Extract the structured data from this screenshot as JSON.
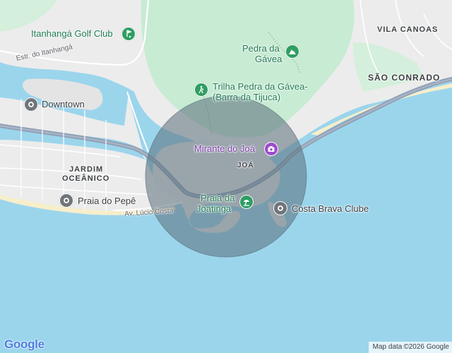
{
  "map": {
    "places": {
      "vila_canoas": "VILA CANOAS",
      "sao_conrado": "SÃO CONRADO",
      "jardim_oceanico_1": "JARDIM",
      "jardim_oceanico_2": "OCEÂNICO",
      "joa": "JOÁ"
    },
    "pois": {
      "itanhanga_golf": "Itanhangá Golf Club",
      "pedra_gavea_1": "Pedra da",
      "pedra_gavea_2": "Gávea",
      "trilha_1": "Trilha Pedra da Gávea-",
      "trilha_2": "(Barra da Tijuca)",
      "downtown": "Downtown",
      "mirante": "Mirante do Joá",
      "praia_pepe": "Praia do Pepê",
      "joatinga_1": "Praia da",
      "joatinga_2": "Joatinga",
      "costa_brava": "Costa Brava Clube"
    },
    "streets": {
      "estr_itanhanga": "Estr. do Itanhangá",
      "av_lucio_costa": "Av. Lúcio Costa"
    },
    "branding": {
      "logo": "Google",
      "attribution_label": "Map data",
      "attribution_text": "©2026 Google"
    },
    "colors": {
      "water": "#9bd5ec",
      "park": "#c8ebd3",
      "urban": "#ececec",
      "highway": "#8e9fb4",
      "circle_fill": "#5a6e7a",
      "pin_green": "#2f9e63",
      "pin_gray": "#70757a",
      "pin_purple": "#9c4dcc"
    },
    "icons": [
      "golf-icon",
      "mountain-icon",
      "hiking-icon",
      "place-pin-icon",
      "camera-icon",
      "beach-icon",
      "place-pin-icon"
    ]
  }
}
